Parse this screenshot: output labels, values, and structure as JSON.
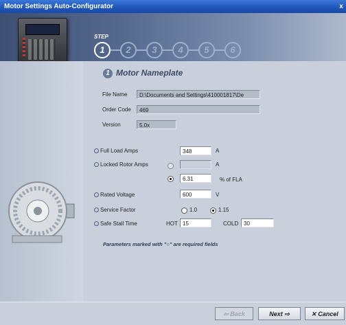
{
  "window": {
    "title": "Motor Settings Auto-Configurator",
    "close_label": "x"
  },
  "header": {
    "step_label": "STEP",
    "steps": [
      "1",
      "2",
      "3",
      "4",
      "5",
      "6"
    ],
    "active_step": 1
  },
  "section": {
    "number": "1",
    "title": "Motor Nameplate"
  },
  "fileinfo": {
    "file_name_label": "File Name",
    "file_name_value": "D:\\Documents and Settings\\410001817\\De",
    "order_code_label": "Order Code",
    "order_code_value": "469",
    "version_label": "Version",
    "version_value": "5.0x"
  },
  "params": {
    "fla_label": "Full Load Amps",
    "fla_value": "348",
    "fla_unit": "A",
    "lra_label": "Locked Rotor Amps",
    "lra_value": "",
    "lra_unit": "A",
    "lra_fla_value": "6.31",
    "lra_fla_unit": "% of FLA",
    "voltage_label": "Rated Voltage",
    "voltage_value": "600",
    "voltage_unit": "V",
    "sf_label": "Service Factor",
    "sf_option1": "1.0",
    "sf_option2": "1.15",
    "sf_selected": "1.15",
    "sst_label": "Safe Stall Time",
    "hot_label": "HOT",
    "hot_value": "15",
    "cold_label": "COLD",
    "cold_value": "30"
  },
  "note": "Parameters marked with \"○\" are required fields",
  "footer": {
    "back_label": "⇦ Back",
    "next_label": "Next ⇨",
    "cancel_label": "✕ Cancel"
  }
}
